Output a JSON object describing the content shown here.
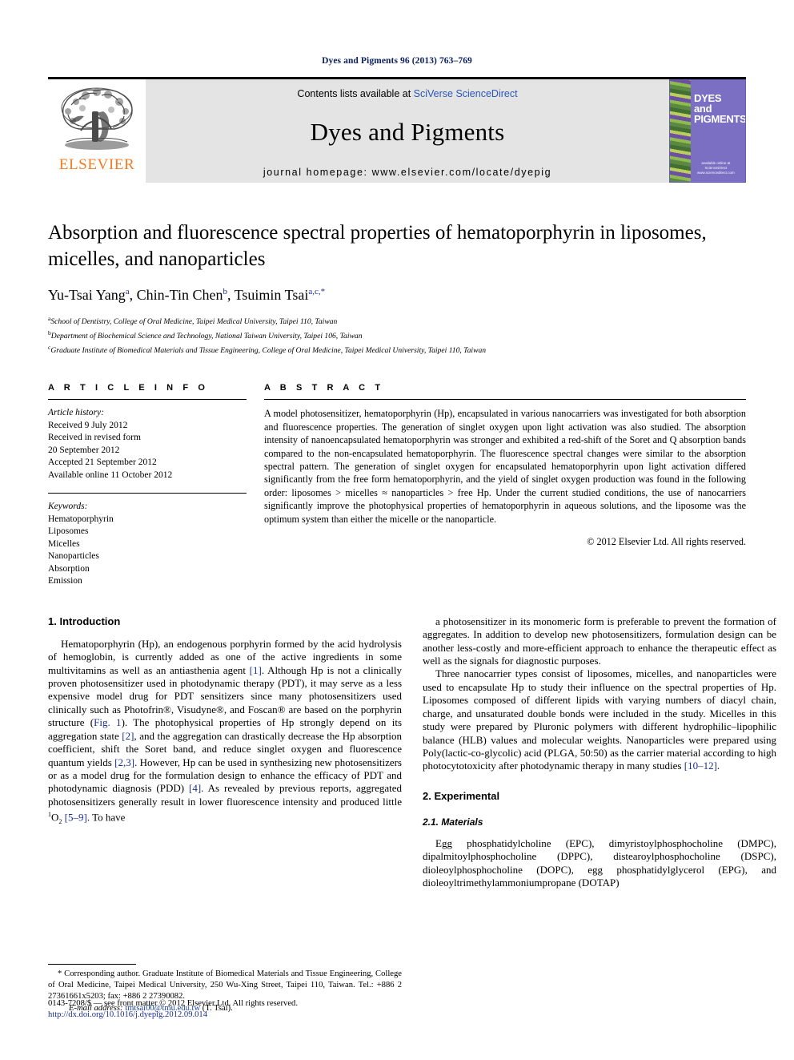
{
  "running_head": "Dyes and Pigments 96 (2013) 763–769",
  "masthead": {
    "publisher_name": "ELSEVIER",
    "contents_prefix": "Contents lists available at ",
    "contents_link": "SciVerse ScienceDirect",
    "journal_title": "Dyes and Pigments",
    "homepage": "journal homepage: www.elsevier.com/locate/dyepig",
    "cover": {
      "line1": "DYES",
      "line2": "and",
      "line3": "PIGMENTS",
      "foot1": "available online at",
      "foot2": "ScienceDirect",
      "foot3": "www.sciencedirect.com"
    }
  },
  "article": {
    "title": "Absorption and fluorescence spectral properties of hematoporphyrin in liposomes, micelles, and nanoparticles",
    "authors_plain": "Yu-Tsai Yang a, Chin-Tin Chen b, Tsuimin Tsai a,c,*",
    "authors": [
      {
        "name": "Yu-Tsai Yang",
        "marks": "a",
        "sep": ", "
      },
      {
        "name": "Chin-Tin Chen",
        "marks": "b",
        "sep": ", "
      },
      {
        "name": "Tsuimin Tsai",
        "marks": "a,c,*",
        "sep": ""
      }
    ],
    "affiliations": [
      {
        "mark": "a",
        "text": "School of Dentistry, College of Oral Medicine, Taipei Medical University, Taipei 110, Taiwan"
      },
      {
        "mark": "b",
        "text": "Department of Biochemical Science and Technology, National Taiwan University, Taipei 106, Taiwan"
      },
      {
        "mark": "c",
        "text": "Graduate Institute of Biomedical Materials and Tissue Engineering, College of Oral Medicine, Taipei Medical University, Taipei 110, Taiwan"
      }
    ]
  },
  "article_info": {
    "label": "A R T I C L E   I N F O",
    "history_label": "Article history:",
    "history": [
      "Received 9 July 2012",
      "Received in revised form",
      "20 September 2012",
      "Accepted 21 September 2012",
      "Available online 11 October 2012"
    ],
    "keywords_label": "Keywords:",
    "keywords": [
      "Hematoporphyrin",
      "Liposomes",
      "Micelles",
      "Nanoparticles",
      "Absorption",
      "Emission"
    ]
  },
  "abstract": {
    "label": "A B S T R A C T",
    "text": "A model photosensitizer, hematoporphyrin (Hp), encapsulated in various nanocarriers was investigated for both absorption and fluorescence properties. The generation of singlet oxygen upon light activation was also studied. The absorption intensity of nanoencapsulated hematoporphyrin was stronger and exhibited a red-shift of the Soret and Q absorption bands compared to the non-encapsulated hematoporphyrin. The fluorescence spectral changes were similar to the absorption spectral pattern. The generation of singlet oxygen for encapsulated hematoporphyrin upon light activation differed significantly from the free form hematoporphyrin, and the yield of singlet oxygen production was found in the following order: liposomes > micelles ≈ nanoparticles > free Hp. Under the current studied conditions, the use of nanocarriers significantly improve the photophysical properties of hematoporphyrin in aqueous solutions, and the liposome was the optimum system than either the micelle or the nanoparticle.",
    "copyright": "© 2012 Elsevier Ltd. All rights reserved."
  },
  "body": {
    "left": {
      "section1_heading": "1.  Introduction",
      "para1_a": "Hematoporphyrin (Hp), an endogenous porphyrin formed by the acid hydrolysis of hemoglobin, is currently added as one of the active ingredients in some multivitamins as well as an antiasthenia agent ",
      "para1_ref1": "[1]",
      "para1_b": ". Although Hp is not a clinically proven photosensitizer used in photodynamic therapy (PDT), it may serve as a less expensive model drug for PDT sensitizers since many photosensitizers used clinically such as Photofrin®, Visudyne®, and Foscan® are based on the porphyrin structure (",
      "para1_figref": "Fig. 1",
      "para1_c": "). The photophysical properties of Hp strongly depend on its aggregation state ",
      "para1_ref2": "[2]",
      "para1_d": ", and the aggregation can drastically decrease the Hp absorption coefficient, shift the Soret band, and reduce singlet oxygen and fluorescence quantum yields ",
      "para1_ref3": "[2,3]",
      "para1_e": ". However, Hp can be used in synthesizing new photosensitizers or as a model drug for the formulation design to enhance the efficacy of PDT and photodynamic diagnosis (PDD) ",
      "para1_ref4": "[4]",
      "para1_f": ". As revealed by previous reports, aggregated photosensitizers generally result in lower fluorescence intensity and produced little ",
      "para1_o2_sup": "1",
      "para1_o2": "O",
      "para1_o2_sub": "2",
      "para1_ref5": " [5–9]",
      "para1_g": ". To have"
    },
    "right": {
      "para2": "a photosensitizer in its monomeric form is preferable to prevent the formation of aggregates. In addition to develop new photosensitizers, formulation design can be another less-costly and more-efficient approach to enhance the therapeutic effect as well as the signals for diagnostic purposes.",
      "para3_a": "Three nanocarrier types consist of liposomes, micelles, and nanoparticles were used to encapsulate Hp to study their influence on the spectral properties of Hp. Liposomes composed of different lipids with varying numbers of diacyl chain, charge, and unsaturated double bonds were included in the study. Micelles in this study were prepared by Pluronic polymers with different hydrophilic–lipophilic balance (HLB) values and molecular weights. Nanoparticles were prepared using Poly(lactic-co-glycolic) acid (PLGA, 50:50) as the carrier material according to high photocytotoxicity after photodynamic therapy in many studies ",
      "para3_ref": "[10–12]",
      "para3_b": ".",
      "section2_heading": "2.  Experimental",
      "subsection21_heading": "2.1.  Materials",
      "para4": "Egg phosphatidylcholine (EPC), dimyristoylphosphocholine (DMPC), dipalmitoylphosphocholine (DPPC), distearoylphosphocholine (DSPC), dioleoylphosphocholine (DOPC), egg phosphatidylglycerol (EPG), and dioleoyltrimethylammoniumpropane (DOTAP)"
    }
  },
  "footnote": {
    "corresponding_a": "* Corresponding author. Graduate Institute of Biomedical Materials and Tissue Engineering, College of Oral Medicine, Taipei Medical University, 250 Wu-Xing Street, Taipei 110, Taiwan. Tel.: +886 2 27361661x5203; fax: +886 2 27390082.",
    "email_label": "E-mail address:",
    "email": "tmtsai00@tmu.edu.tw",
    "email_suffix": " (T. Tsai)."
  },
  "page_footer": {
    "issn_line": "0143-7208/$ — see front matter © 2012 Elsevier Ltd. All rights reserved.",
    "doi": "http://dx.doi.org/10.1016/j.dyepig.2012.09.014"
  },
  "colors": {
    "link": "#1a3fa0",
    "reference": "#1a2f8f",
    "elsevier_orange": "#F47B20",
    "cover_purple": "#7b6fc4",
    "band_gray": "#e4e4e4"
  }
}
